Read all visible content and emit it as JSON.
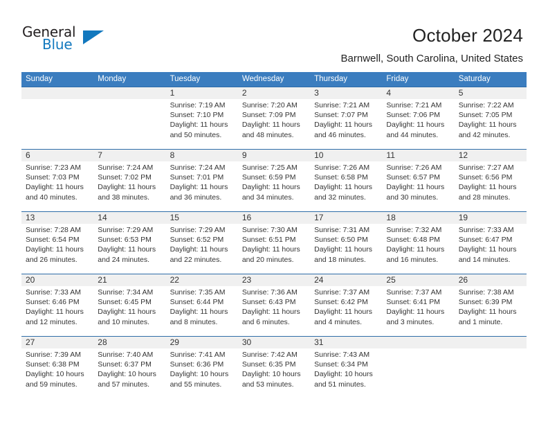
{
  "brand": {
    "name_part1": "General",
    "name_part2": "Blue",
    "logo_icon": "blue-triangle-icon",
    "accent_color": "#1278be"
  },
  "header": {
    "title": "October 2024",
    "location": "Barnwell, South Carolina, United States",
    "header_bg_color": "#3b7dbf",
    "row_divider_color": "#2e6ca8",
    "daynum_band_color": "#f0f0f0"
  },
  "weekdays": [
    "Sunday",
    "Monday",
    "Tuesday",
    "Wednesday",
    "Thursday",
    "Friday",
    "Saturday"
  ],
  "weeks": [
    [
      {
        "day": "",
        "info": "",
        "empty": true
      },
      {
        "day": "",
        "info": "",
        "empty": true
      },
      {
        "day": "1",
        "info": "Sunrise: 7:19 AM\nSunset: 7:10 PM\nDaylight: 11 hours\nand 50 minutes."
      },
      {
        "day": "2",
        "info": "Sunrise: 7:20 AM\nSunset: 7:09 PM\nDaylight: 11 hours\nand 48 minutes."
      },
      {
        "day": "3",
        "info": "Sunrise: 7:21 AM\nSunset: 7:07 PM\nDaylight: 11 hours\nand 46 minutes."
      },
      {
        "day": "4",
        "info": "Sunrise: 7:21 AM\nSunset: 7:06 PM\nDaylight: 11 hours\nand 44 minutes."
      },
      {
        "day": "5",
        "info": "Sunrise: 7:22 AM\nSunset: 7:05 PM\nDaylight: 11 hours\nand 42 minutes."
      }
    ],
    [
      {
        "day": "6",
        "info": "Sunrise: 7:23 AM\nSunset: 7:03 PM\nDaylight: 11 hours\nand 40 minutes."
      },
      {
        "day": "7",
        "info": "Sunrise: 7:24 AM\nSunset: 7:02 PM\nDaylight: 11 hours\nand 38 minutes."
      },
      {
        "day": "8",
        "info": "Sunrise: 7:24 AM\nSunset: 7:01 PM\nDaylight: 11 hours\nand 36 minutes."
      },
      {
        "day": "9",
        "info": "Sunrise: 7:25 AM\nSunset: 6:59 PM\nDaylight: 11 hours\nand 34 minutes."
      },
      {
        "day": "10",
        "info": "Sunrise: 7:26 AM\nSunset: 6:58 PM\nDaylight: 11 hours\nand 32 minutes."
      },
      {
        "day": "11",
        "info": "Sunrise: 7:26 AM\nSunset: 6:57 PM\nDaylight: 11 hours\nand 30 minutes."
      },
      {
        "day": "12",
        "info": "Sunrise: 7:27 AM\nSunset: 6:56 PM\nDaylight: 11 hours\nand 28 minutes."
      }
    ],
    [
      {
        "day": "13",
        "info": "Sunrise: 7:28 AM\nSunset: 6:54 PM\nDaylight: 11 hours\nand 26 minutes."
      },
      {
        "day": "14",
        "info": "Sunrise: 7:29 AM\nSunset: 6:53 PM\nDaylight: 11 hours\nand 24 minutes."
      },
      {
        "day": "15",
        "info": "Sunrise: 7:29 AM\nSunset: 6:52 PM\nDaylight: 11 hours\nand 22 minutes."
      },
      {
        "day": "16",
        "info": "Sunrise: 7:30 AM\nSunset: 6:51 PM\nDaylight: 11 hours\nand 20 minutes."
      },
      {
        "day": "17",
        "info": "Sunrise: 7:31 AM\nSunset: 6:50 PM\nDaylight: 11 hours\nand 18 minutes."
      },
      {
        "day": "18",
        "info": "Sunrise: 7:32 AM\nSunset: 6:48 PM\nDaylight: 11 hours\nand 16 minutes."
      },
      {
        "day": "19",
        "info": "Sunrise: 7:33 AM\nSunset: 6:47 PM\nDaylight: 11 hours\nand 14 minutes."
      }
    ],
    [
      {
        "day": "20",
        "info": "Sunrise: 7:33 AM\nSunset: 6:46 PM\nDaylight: 11 hours\nand 12 minutes."
      },
      {
        "day": "21",
        "info": "Sunrise: 7:34 AM\nSunset: 6:45 PM\nDaylight: 11 hours\nand 10 minutes."
      },
      {
        "day": "22",
        "info": "Sunrise: 7:35 AM\nSunset: 6:44 PM\nDaylight: 11 hours\nand 8 minutes."
      },
      {
        "day": "23",
        "info": "Sunrise: 7:36 AM\nSunset: 6:43 PM\nDaylight: 11 hours\nand 6 minutes."
      },
      {
        "day": "24",
        "info": "Sunrise: 7:37 AM\nSunset: 6:42 PM\nDaylight: 11 hours\nand 4 minutes."
      },
      {
        "day": "25",
        "info": "Sunrise: 7:37 AM\nSunset: 6:41 PM\nDaylight: 11 hours\nand 3 minutes."
      },
      {
        "day": "26",
        "info": "Sunrise: 7:38 AM\nSunset: 6:39 PM\nDaylight: 11 hours\nand 1 minute."
      }
    ],
    [
      {
        "day": "27",
        "info": "Sunrise: 7:39 AM\nSunset: 6:38 PM\nDaylight: 10 hours\nand 59 minutes."
      },
      {
        "day": "28",
        "info": "Sunrise: 7:40 AM\nSunset: 6:37 PM\nDaylight: 10 hours\nand 57 minutes."
      },
      {
        "day": "29",
        "info": "Sunrise: 7:41 AM\nSunset: 6:36 PM\nDaylight: 10 hours\nand 55 minutes."
      },
      {
        "day": "30",
        "info": "Sunrise: 7:42 AM\nSunset: 6:35 PM\nDaylight: 10 hours\nand 53 minutes."
      },
      {
        "day": "31",
        "info": "Sunrise: 7:43 AM\nSunset: 6:34 PM\nDaylight: 10 hours\nand 51 minutes."
      },
      {
        "day": "",
        "info": "",
        "empty": true
      },
      {
        "day": "",
        "info": "",
        "empty": true
      }
    ]
  ]
}
